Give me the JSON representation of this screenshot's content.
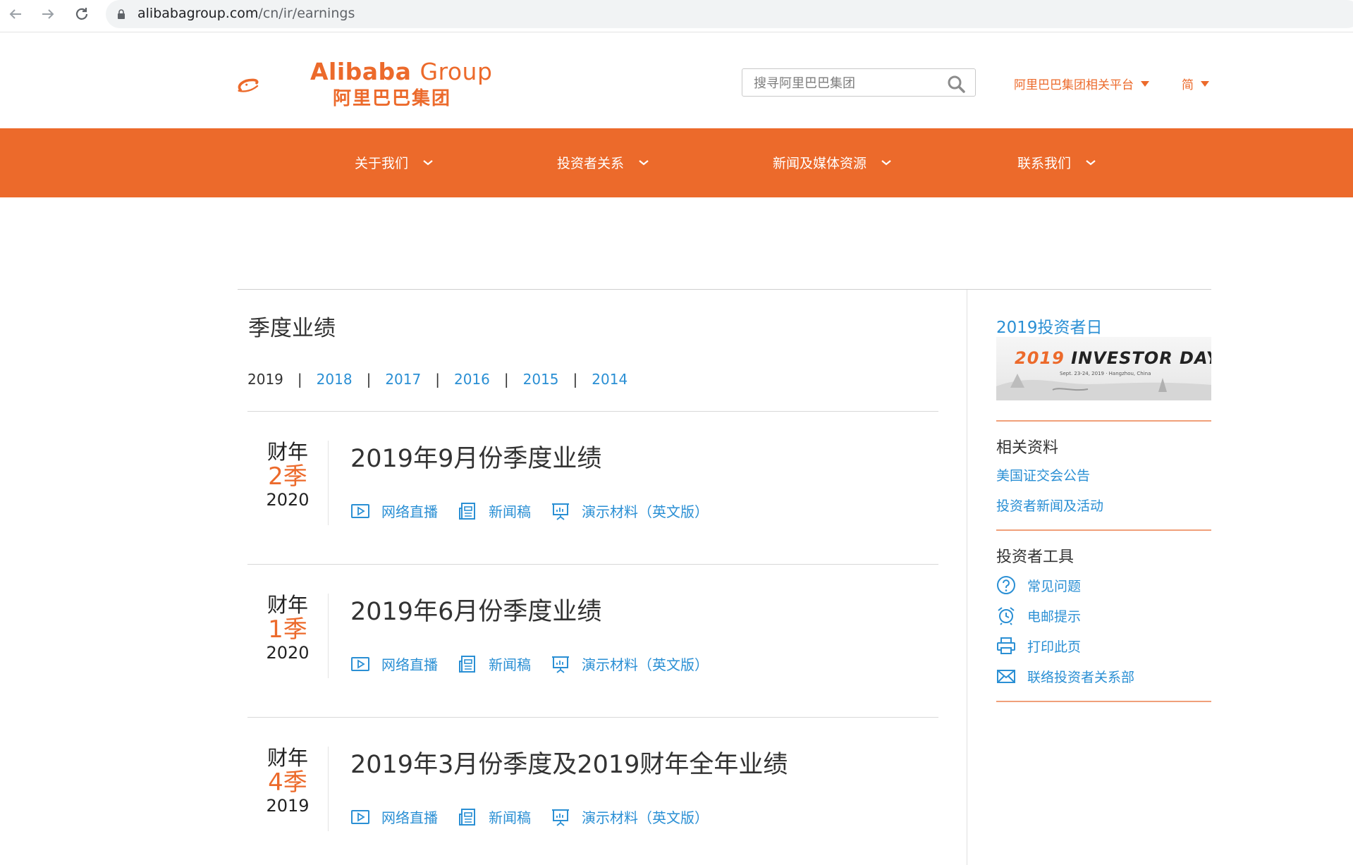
{
  "browser": {
    "url_domain": "alibabagroup.com",
    "url_path": "/cn/ir/earnings"
  },
  "header": {
    "logo_en_bold": "Alibaba",
    "logo_en_light": "Group",
    "logo_cn": "阿里巴巴集团",
    "search_placeholder": "搜寻阿里巴巴集团",
    "platform_link": "阿里巴巴集团相关平台",
    "lang": "简"
  },
  "nav": {
    "items": [
      {
        "label": "关于我们"
      },
      {
        "label": "投资者关系"
      },
      {
        "label": "新闻及媒体资源"
      },
      {
        "label": "联系我们"
      }
    ]
  },
  "main": {
    "title": "季度业绩",
    "years": [
      "2019",
      "2018",
      "2017",
      "2016",
      "2015",
      "2014"
    ],
    "results": [
      {
        "fy_label": "财年",
        "quarter": "2季",
        "fy_year": "2020",
        "title": "2019年9月份季度业绩",
        "links": [
          "网络直播",
          "新闻稿",
          "演示材料（英文版）"
        ]
      },
      {
        "fy_label": "财年",
        "quarter": "1季",
        "fy_year": "2020",
        "title": "2019年6月份季度业绩",
        "links": [
          "网络直播",
          "新闻稿",
          "演示材料（英文版）"
        ]
      },
      {
        "fy_label": "财年",
        "quarter": "4季",
        "fy_year": "2019",
        "title": "2019年3月份季度及2019财年全年业绩",
        "links": [
          "网络直播",
          "新闻稿",
          "演示材料（英文版）"
        ]
      }
    ]
  },
  "sidebar": {
    "investor_day_title": "2019投资者日",
    "banner": {
      "year": "2019",
      "text": "INVESTOR DAY",
      "sub": "Sept. 23-24, 2019 · Hangzhou, China"
    },
    "related_title": "相关资料",
    "related_links": [
      "美国证交会公告",
      "投资者新闻及活动"
    ],
    "tools_title": "投资者工具",
    "tools": [
      {
        "label": "常见问题",
        "icon": "question-icon"
      },
      {
        "label": "电邮提示",
        "icon": "alarm-clock-icon"
      },
      {
        "label": "打印此页",
        "icon": "printer-icon"
      },
      {
        "label": "联络投资者关系部",
        "icon": "envelope-icon"
      }
    ]
  },
  "colors": {
    "brand_orange": "#ec6a2b",
    "link_blue": "#2a8fd4"
  }
}
